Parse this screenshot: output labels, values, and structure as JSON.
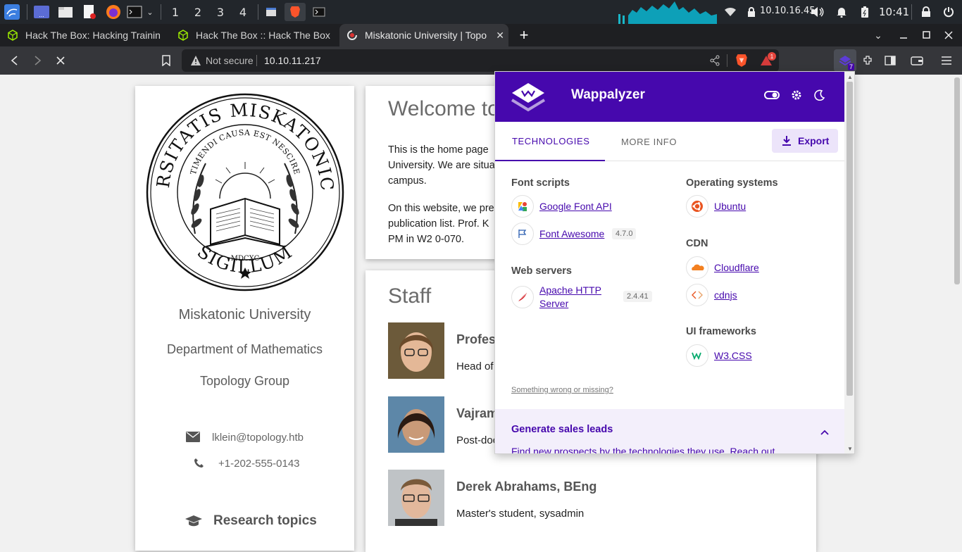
{
  "taskbar": {
    "workspaces": [
      "1",
      "2",
      "3",
      "4"
    ],
    "ip": "10.10.16.45",
    "time": "10:41",
    "launcher_label": "..."
  },
  "tabs": [
    {
      "title": "Hack The Box: Hacking Trainin"
    },
    {
      "title": "Hack The Box :: Hack The Box"
    },
    {
      "title": "Miskatonic University | Topo"
    }
  ],
  "toolbar": {
    "security_label": "Not secure",
    "url": "10.10.11.217",
    "brave_badge": "1",
    "wappalyzer_badge": "7"
  },
  "sidebar": {
    "university": "Miskatonic University",
    "department": "Department of Mathematics",
    "group": "Topology Group",
    "email": "lklein@topology.htb",
    "phone": "+1-202-555-0143",
    "research_heading": "Research topics",
    "seal_top": "UNIVERSITATIS MISKATONICENSIS",
    "seal_bottom": "SIGILLUM",
    "seal_motto": "TIMENDI CAUSA EST NESCIRE",
    "seal_year": "MDCXC"
  },
  "welcome": {
    "heading": "Welcome to",
    "p1_lines": [
      "This is the home page",
      "University. We are situa",
      "campus."
    ],
    "p2_lines": [
      "On this website, we pre",
      "publication list. Prof. K",
      "PM in W2 0-070."
    ]
  },
  "staff": {
    "heading": "Staff",
    "members": [
      {
        "name": "Profess",
        "role": "Head of"
      },
      {
        "name": "Vajram",
        "role": "Post-doc"
      },
      {
        "name": "Derek Abrahams, BEng",
        "role": "Master's student, sysadmin"
      }
    ]
  },
  "wappalyzer": {
    "brand": "Wappalyzer",
    "tab_technologies": "TECHNOLOGIES",
    "tab_more_info": "MORE INFO",
    "export_label": "Export",
    "left": [
      {
        "category": "Font scripts",
        "items": [
          {
            "name": "Google Font API",
            "version": ""
          },
          {
            "name": "Font Awesome",
            "version": "4.7.0"
          }
        ]
      },
      {
        "category": "Web servers",
        "items": [
          {
            "name": "Apache HTTP Server",
            "version": "2.4.41"
          }
        ]
      }
    ],
    "right": [
      {
        "category": "Operating systems",
        "items": [
          {
            "name": "Ubuntu"
          }
        ]
      },
      {
        "category": "CDN",
        "items": [
          {
            "name": "Cloudflare"
          },
          {
            "name": "cdnjs"
          }
        ]
      },
      {
        "category": "UI frameworks",
        "items": [
          {
            "name": "W3.CSS"
          }
        ]
      }
    ],
    "wrong_link": "Something wrong or missing?",
    "leads_heading": "Generate sales leads",
    "leads_text": "Find new prospects by the technologies they use. Reach out"
  },
  "colors": {
    "wappalyzer_purple": "#4608ad",
    "taskbar": "#22262b",
    "tabbar": "#1e1f22",
    "toolbar": "#35363a"
  }
}
